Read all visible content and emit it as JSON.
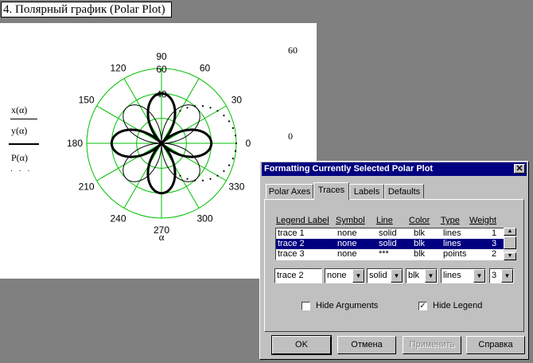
{
  "worksheet": {
    "title": "4. Полярный график (Polar Plot)"
  },
  "plot": {
    "angle_labels": [
      "90",
      "120",
      "60",
      "150",
      "30",
      "180",
      "0",
      "210",
      "330",
      "240",
      "300",
      "270"
    ],
    "radial_labels": [
      "60",
      "40"
    ],
    "angle_var": "α",
    "left_labels": [
      "x(α)",
      "y(α)",
      "P(α)"
    ],
    "right_top_value": "60",
    "right_bottom_value": "0",
    "grid_color": "#00c000",
    "chart_data": {
      "type": "polar",
      "rlim": [
        0,
        60
      ],
      "radial_ticks": [
        20,
        40,
        60
      ],
      "angular_ticks_deg": [
        0,
        30,
        60,
        90,
        120,
        150,
        180,
        210,
        240,
        270,
        300,
        330
      ],
      "series": [
        {
          "name": "trace 1",
          "line": "solid",
          "weight": 1,
          "r_expr": "|40·sin(2α)|"
        },
        {
          "name": "trace 2",
          "line": "solid",
          "weight": 3,
          "r_expr": "|40·cos(2α)|"
        },
        {
          "name": "trace 3",
          "line": "points",
          "weight": 2,
          "r_expr": "60·cos(α)"
        }
      ]
    }
  },
  "dialog": {
    "title": "Formatting Currently Selected Polar Plot",
    "close_glyph": "✕",
    "tabs": [
      "Polar Axes",
      "Traces",
      "Labels",
      "Defaults"
    ],
    "active_tab": "Traces",
    "columns": [
      "Legend Label",
      "Symbol",
      "Line",
      "Color",
      "Type",
      "Weight"
    ],
    "rows": [
      {
        "label": "trace 1",
        "symbol": "none",
        "line": "solid",
        "color": "blk",
        "type": "lines",
        "weight": "1"
      },
      {
        "label": "trace 2",
        "symbol": "none",
        "line": "solid",
        "color": "blk",
        "type": "lines",
        "weight": "3"
      },
      {
        "label": "trace 3",
        "symbol": "none",
        "line": "***",
        "color": "blk",
        "type": "points",
        "weight": "2"
      }
    ],
    "selected_row": 1,
    "editor": {
      "label": "trace 2",
      "symbol": "none",
      "line": "solid",
      "color": "blk",
      "type": "lines",
      "weight": "3"
    },
    "hide_arguments": {
      "label": "Hide Arguments",
      "checked": false
    },
    "hide_legend": {
      "label": "Hide Legend",
      "checked": true
    },
    "buttons": {
      "ok": "OK",
      "cancel": "Отмена",
      "apply": "Применить",
      "help": "Справка"
    }
  }
}
